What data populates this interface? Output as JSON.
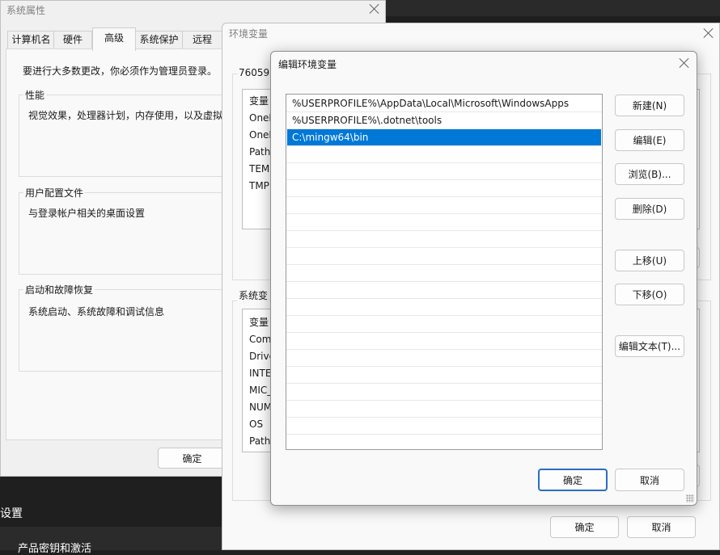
{
  "system_properties": {
    "title": "系统属性",
    "tabs": [
      "计算机名",
      "硬件",
      "高级",
      "系统保护",
      "远程"
    ],
    "admin_note": "要进行大多数更改，你必须作为管理员登录。",
    "performance": {
      "label": "性能",
      "desc": "视觉效果，处理器计划，内存使用，以及虚拟"
    },
    "user_profiles": {
      "label": "用户配置文件",
      "desc": "与登录帐户相关的桌面设置"
    },
    "startup_recovery": {
      "label": "启动和故障恢复",
      "desc": "系统启动、系统故障和调试信息"
    },
    "ok_label": "确定"
  },
  "env_vars": {
    "title": "环境变量",
    "user_section_label": "76059",
    "col_header": "变量",
    "user_vars": [
      "OneD",
      "OneD",
      "Path",
      "TEMI",
      "TMP"
    ],
    "system_section_label": "系统变",
    "system_vars": [
      "Com",
      "Drive",
      "INTE",
      "MIC_",
      "NUM",
      "OS",
      "Path"
    ],
    "ok_label": "确定",
    "cancel_label": "取消"
  },
  "edit_env": {
    "title": "编辑环境变量",
    "entries": [
      "%USERPROFILE%\\AppData\\Local\\Microsoft\\WindowsApps",
      "%USERPROFILE%\\.dotnet\\tools",
      "C:\\mingw64\\bin"
    ],
    "selected_index": 2,
    "buttons": {
      "new": "新建(N)",
      "edit": "编辑(E)",
      "browse": "浏览(B)...",
      "delete": "删除(D)",
      "move_up": "上移(U)",
      "move_down": "下移(O)",
      "edit_text": "编辑文本(T)...",
      "ok": "确定",
      "cancel": "取消"
    }
  },
  "background_settings": {
    "title_fragment": "设置",
    "item_fragment": "产品密钥和激活"
  },
  "colors": {
    "selection": "#0078d7",
    "primary_border": "#2b6cc4"
  }
}
